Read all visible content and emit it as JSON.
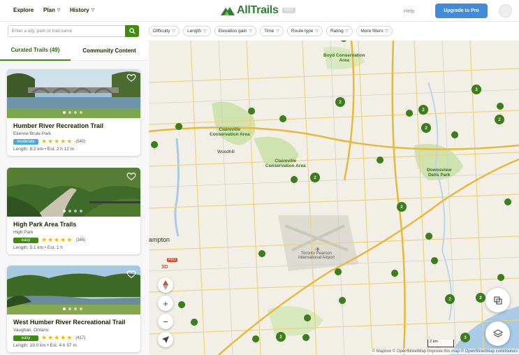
{
  "nav": {
    "explore": "Explore",
    "plan": "Plan",
    "history": "History",
    "logo": "AllTrails",
    "logo_tag": "PRO",
    "help": "Help",
    "upgrade": "Upgrade to Pro"
  },
  "search": {
    "placeholder": "Enter a city, park or trail name"
  },
  "filters": [
    "Difficulty",
    "Length",
    "Elevation gain",
    "Time",
    "Route type",
    "Rating",
    "More filters"
  ],
  "tabs": {
    "curated": "Curated Trails (49)",
    "community": "Community Content"
  },
  "trails": [
    {
      "name": "Humber River Recreation Trail",
      "location": "Etienne Brule Park",
      "difficulty": "moderate",
      "difficulty_color": "#4aa9d6",
      "rating": 4.5,
      "stars": "★★★★★",
      "reviews": "(540)",
      "meta": "Length: 8.2 km  •  Est. 2 h 12 m"
    },
    {
      "name": "High Park Area Trails",
      "location": "High Park",
      "difficulty": "easy",
      "difficulty_color": "#428a13",
      "rating": 4.5,
      "stars": "★★★★★",
      "reviews": "(346)",
      "meta": "Length: 5.1 km  •  Est. 1 h"
    },
    {
      "name": "West Humber River Recreational Trail",
      "location": "Vaughan, Ontario",
      "difficulty": "easy",
      "difficulty_color": "#428a13",
      "rating": 4.5,
      "stars": "★★★★★",
      "reviews": "(417)",
      "meta": "Length: 19.0 km  •  Est. 4 h 57 m"
    }
  ],
  "map": {
    "labels": {
      "boyd": "Boyd Conservation\nArea",
      "claireville1": "Claireville\nConservation Area",
      "woodhill": "Woodhill",
      "claireville2": "Claireville\nConservation Area",
      "downsview": "Downsview\nDells Park",
      "brampton": "ampton",
      "airport": "Toronto Pearson\nInternational Airport"
    },
    "scale": "2 km",
    "attribution": "© Mapbox © OpenStreetMap Improve this map © OpenStreetMap contributors",
    "pro3d_badge": "PRO",
    "pro3d_label": "3D"
  },
  "colors": {
    "accent": "#428a13",
    "brand": "#2f7d31",
    "upgrade": "#428bdb"
  }
}
